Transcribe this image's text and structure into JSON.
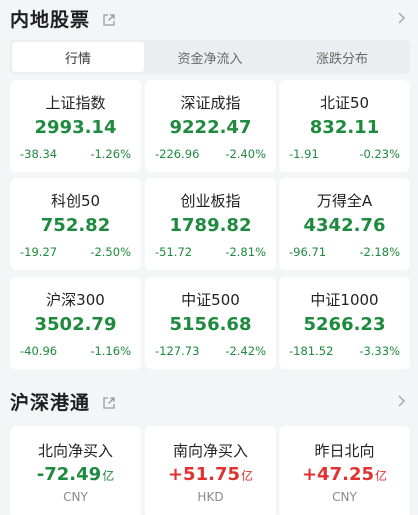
{
  "domestic": {
    "title": "内地股票",
    "tabs": [
      {
        "label": "行情",
        "active": true
      },
      {
        "label": "资金净流入",
        "active": false
      },
      {
        "label": "涨跌分布",
        "active": false
      }
    ],
    "indices": [
      {
        "name": "上证指数",
        "price": "2993.14",
        "change": "-38.34",
        "pct": "-1.26%"
      },
      {
        "name": "深证成指",
        "price": "9222.47",
        "change": "-226.96",
        "pct": "-2.40%"
      },
      {
        "name": "北证50",
        "price": "832.11",
        "change": "-1.91",
        "pct": "-0.23%"
      },
      {
        "name": "科创50",
        "price": "752.82",
        "change": "-19.27",
        "pct": "-2.50%"
      },
      {
        "name": "创业板指",
        "price": "1789.82",
        "change": "-51.72",
        "pct": "-2.81%"
      },
      {
        "name": "万得全A",
        "price": "4342.76",
        "change": "-96.71",
        "pct": "-2.18%"
      },
      {
        "name": "沪深300",
        "price": "3502.79",
        "change": "-40.96",
        "pct": "-1.16%"
      },
      {
        "name": "中证500",
        "price": "5156.68",
        "change": "-127.73",
        "pct": "-2.42%"
      },
      {
        "name": "中证1000",
        "price": "5266.23",
        "change": "-181.52",
        "pct": "-3.33%"
      }
    ],
    "colors": {
      "down": "#1e8a3e",
      "up": "#e03232"
    }
  },
  "connect": {
    "title": "沪深港通",
    "flows": [
      {
        "name": "北向净买入",
        "value": "-72.49",
        "unit": "亿",
        "currency": "CNY",
        "direction": "negative"
      },
      {
        "name": "南向净买入",
        "value": "+51.75",
        "unit": "亿",
        "currency": "HKD",
        "direction": "positive"
      },
      {
        "name": "昨日北向",
        "value": "+47.25",
        "unit": "亿",
        "currency": "CNY",
        "direction": "positive"
      }
    ]
  },
  "icons": {
    "share": "share-icon",
    "more": "chevron-right-icon"
  }
}
